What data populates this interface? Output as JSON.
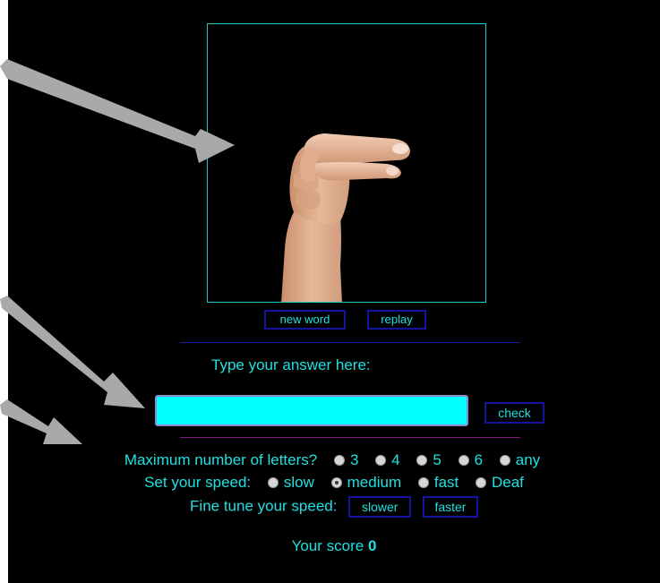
{
  "buttons": {
    "new_word": "new word",
    "replay": "replay",
    "check": "check",
    "slower": "slower",
    "faster": "faster"
  },
  "answer": {
    "prompt": "Type your answer here:",
    "value": ""
  },
  "letters": {
    "label": "Maximum number of letters?",
    "options": [
      "3",
      "4",
      "5",
      "6",
      "any"
    ],
    "selected": ""
  },
  "speed": {
    "label": "Set your speed:",
    "options": [
      "slow",
      "medium",
      "fast",
      "Deaf"
    ],
    "selected": "medium"
  },
  "fine_tune": {
    "label": "Fine tune your speed:"
  },
  "score": {
    "label": "Your score",
    "value": "0"
  },
  "colors": {
    "accent": "#1fe0e0",
    "input_bg": "#00ffff",
    "button_border": "#1414a0",
    "background": "#000000",
    "arrow": "#a9a9a9"
  },
  "icons": {
    "arrows": "pointer-arrow-icon",
    "hand": "fingerspelling-hand-image"
  }
}
